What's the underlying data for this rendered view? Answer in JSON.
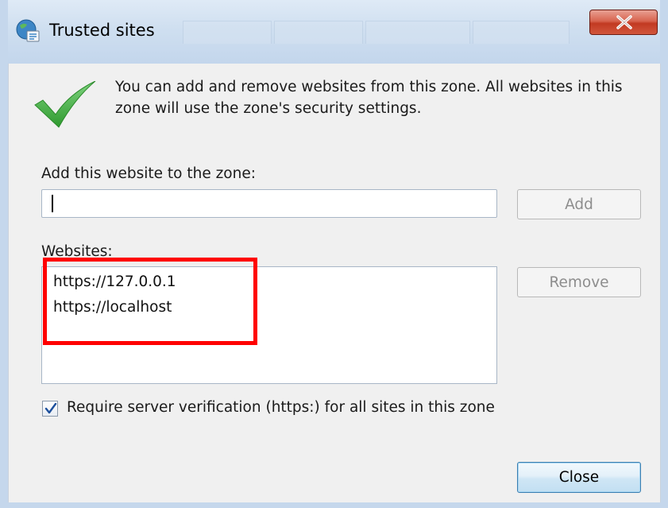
{
  "window": {
    "title": "Trusted sites"
  },
  "info": {
    "message": "You can add and remove websites from this zone. All websites in this zone will use the zone's security settings."
  },
  "add_site": {
    "label": "Add this website to the zone:",
    "value": "",
    "add_button": "Add"
  },
  "websites": {
    "label": "Websites:",
    "items": [
      "https://127.0.0.1",
      "https://localhost"
    ],
    "remove_button": "Remove"
  },
  "verification": {
    "checked": true,
    "label": "Require server verification (https:) for all sites in this zone"
  },
  "footer": {
    "close_button": "Close"
  },
  "icons": {
    "title": "globe-shield-icon",
    "info": "green-checkmark-icon",
    "close": "close-x-icon"
  },
  "colors": {
    "highlight": "#ff0000",
    "check_green": "#3aa83a",
    "close_red": "#c23a22"
  }
}
